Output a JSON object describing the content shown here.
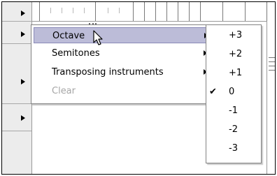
{
  "context_menu": {
    "items": [
      {
        "label": "Octave",
        "has_submenu": true,
        "highlighted": true,
        "enabled": true
      },
      {
        "label": "Semitones",
        "has_submenu": true,
        "highlighted": false,
        "enabled": true
      },
      {
        "label": "Transposing instruments",
        "has_submenu": true,
        "highlighted": false,
        "enabled": true
      },
      {
        "label": "Clear",
        "has_submenu": false,
        "highlighted": false,
        "enabled": false
      }
    ]
  },
  "octave_submenu": {
    "check_mark": "✔",
    "items": [
      {
        "label": "+3",
        "checked": false
      },
      {
        "label": "+2",
        "checked": false
      },
      {
        "label": "+1",
        "checked": false
      },
      {
        "label": "0",
        "checked": true
      },
      {
        "label": "-1",
        "checked": false
      },
      {
        "label": "-2",
        "checked": false
      },
      {
        "label": "-3",
        "checked": false
      }
    ]
  },
  "colors": {
    "highlight": "#bcbcd8",
    "disabled_text": "#a6a6a6"
  }
}
